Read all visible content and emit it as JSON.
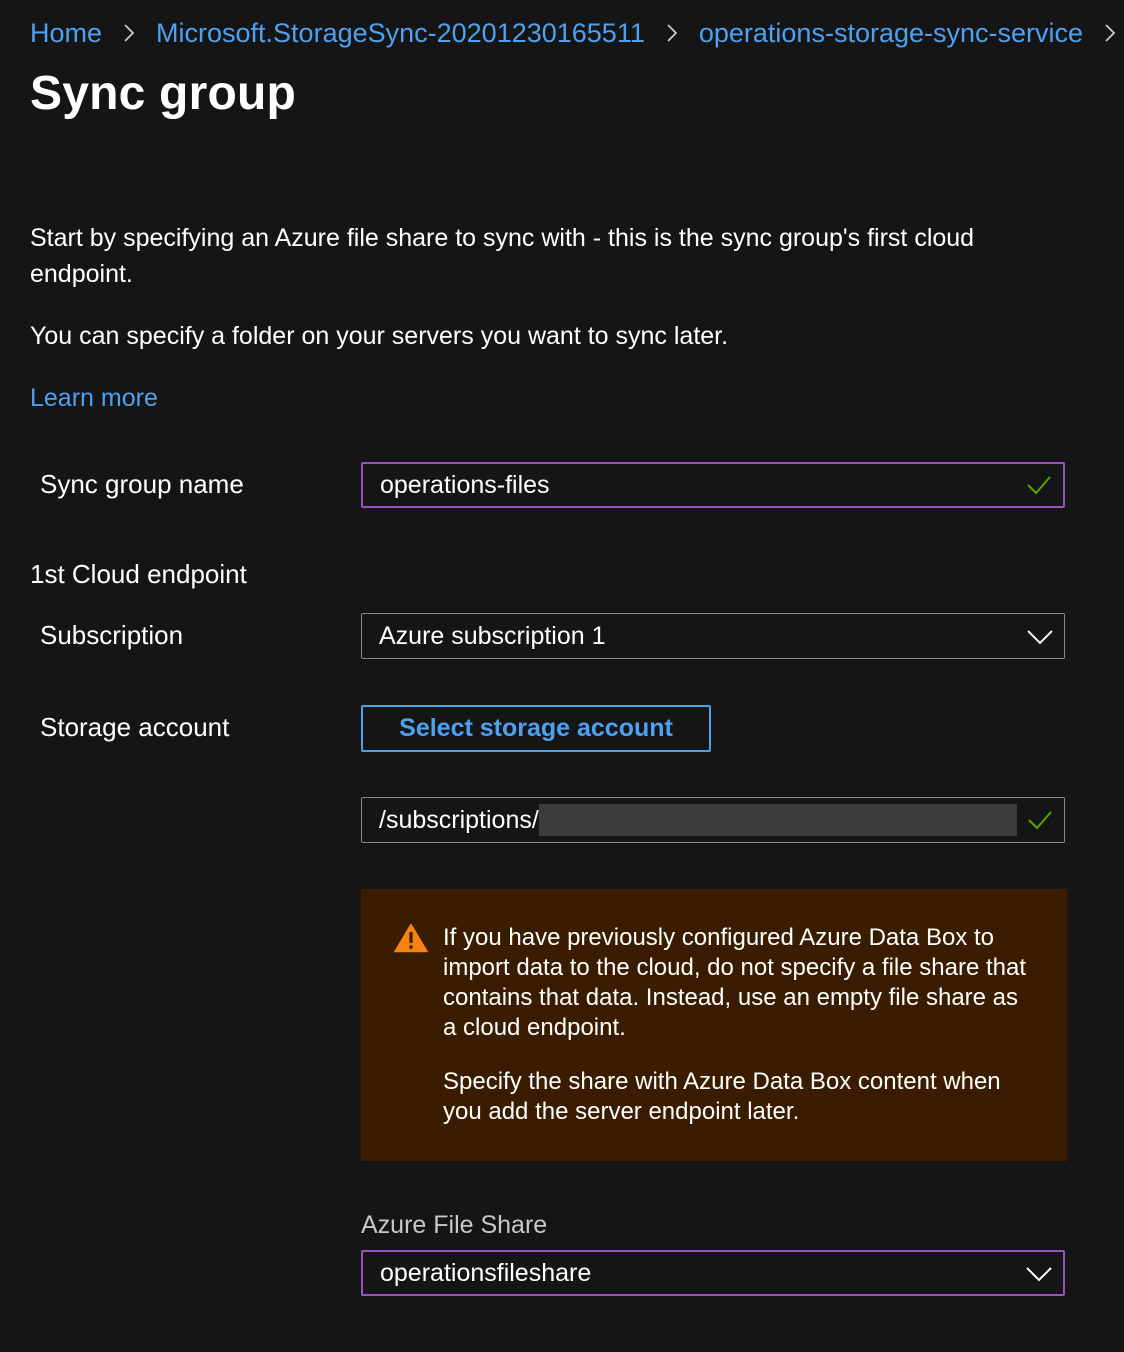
{
  "breadcrumb": {
    "items": [
      {
        "label": "Home"
      },
      {
        "label": "Microsoft.StorageSync-20201230165511"
      },
      {
        "label": "operations-storage-sync-service"
      }
    ]
  },
  "page": {
    "title": "Sync group"
  },
  "intro": {
    "text1": "Start by specifying an Azure file share to sync with - this is the sync group's first cloud endpoint.",
    "text2": "You can specify a folder on your servers you want to sync later.",
    "learn_more": "Learn more"
  },
  "form": {
    "sync_group_name": {
      "label": "Sync group name",
      "value": "operations-files",
      "valid": true
    },
    "section_heading": "1st Cloud endpoint",
    "subscription": {
      "label": "Subscription",
      "value": "Azure subscription 1"
    },
    "storage_account": {
      "label": "Storage account",
      "button_label": "Select storage account",
      "value_prefix": "/subscriptions/",
      "valid": true
    },
    "warning": {
      "paragraph1": "If you have previously configured Azure Data Box to import data to the cloud, do not specify a file share that contains that data. Instead, use an empty file share as a cloud endpoint.",
      "paragraph2": "Specify the share with Azure Data Box content when you add the server endpoint later."
    },
    "file_share": {
      "label": "Azure File Share",
      "value": "operationsfileshare"
    }
  },
  "icons": {
    "breadcrumb_separator": "chevron-right-icon",
    "valid": "checkmark-icon",
    "dropdown": "chevron-down-icon",
    "warning": "warning-icon"
  },
  "colors": {
    "background": "#151515",
    "link": "#4ea1f0",
    "focus_border": "#9d4fc7",
    "valid_check": "#57a300",
    "warning_bg": "#3a1d00",
    "warning_icon": "#f7830f"
  }
}
